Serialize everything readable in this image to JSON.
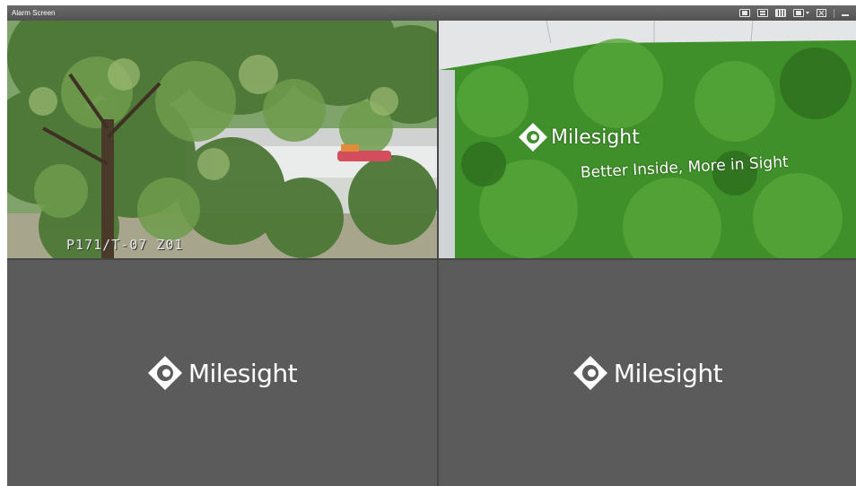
{
  "window": {
    "title": "Alarm Screen"
  },
  "toolbar": {
    "buttons": [
      {
        "name": "layout-1-icon"
      },
      {
        "name": "layout-4-icon"
      },
      {
        "name": "layout-9-icon"
      },
      {
        "name": "layout-more-icon"
      },
      {
        "name": "close-screen-icon"
      },
      {
        "name": "minimize-icon"
      }
    ]
  },
  "channels": [
    {
      "osd": "P171/T-07 Z01"
    },
    {
      "brand": "Milesight",
      "tagline": "Better Inside, More in Sight"
    },
    {
      "placeholder": "Milesight"
    },
    {
      "placeholder": "Milesight"
    }
  ],
  "colors": {
    "titlebar": "#5a5a5a",
    "empty_channel": "#5b5b5b",
    "divider": "#474747"
  }
}
